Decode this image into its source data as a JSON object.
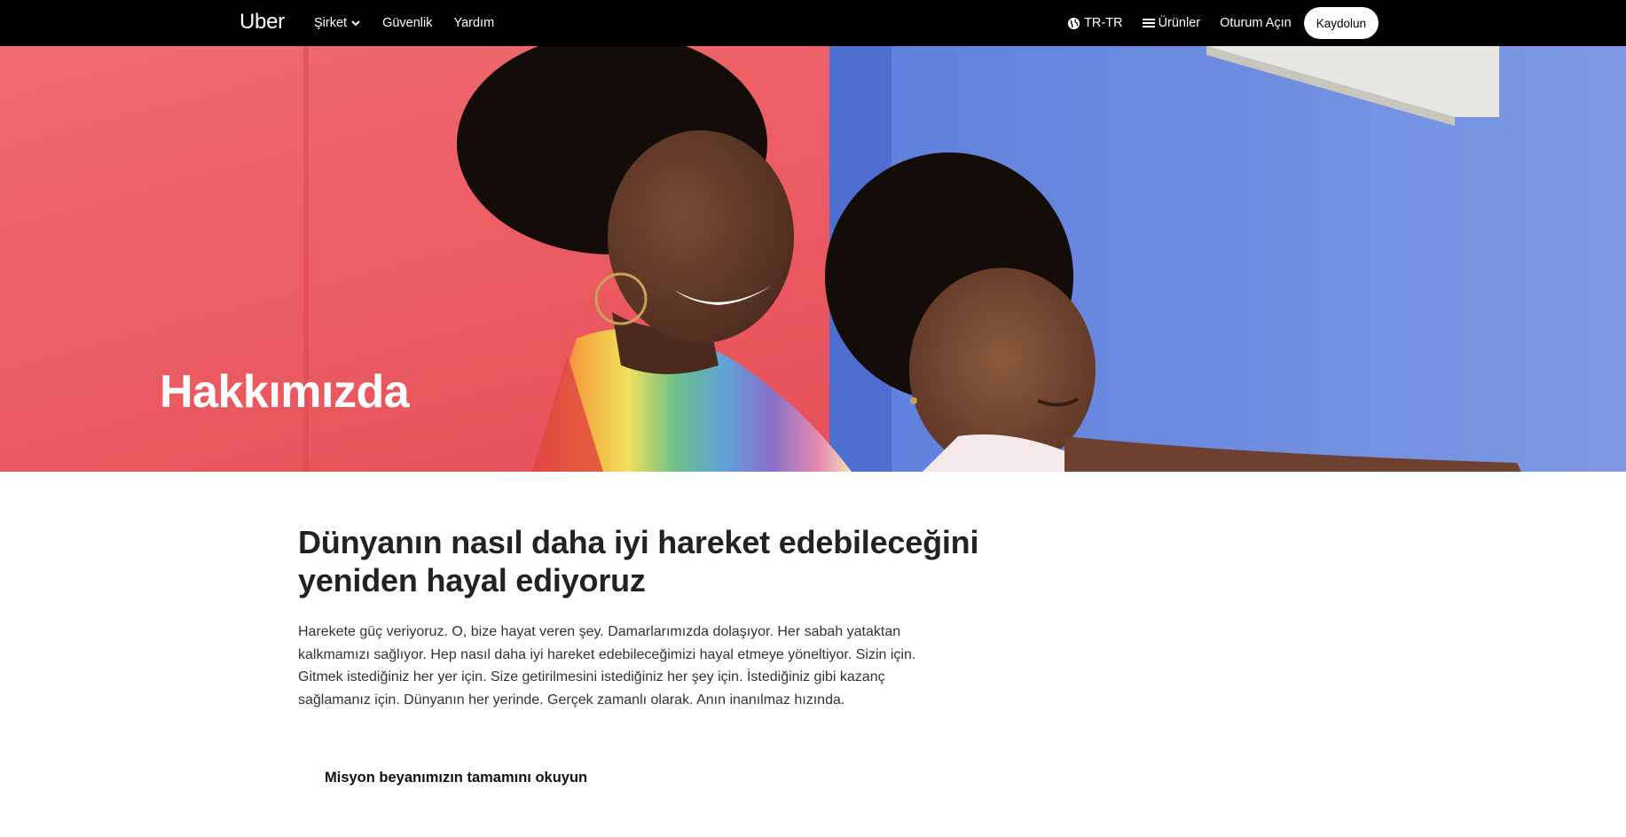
{
  "nav": {
    "brand": "Uber",
    "left_items": [
      {
        "label": "Şirket",
        "has_dropdown": true
      },
      {
        "label": "Güvenlik"
      },
      {
        "label": "Yardım"
      }
    ],
    "locale": "TR-TR",
    "products": "Ürünler",
    "login": "Oturum Açın",
    "signup": "Kaydolun"
  },
  "hero": {
    "title": "Hakkımızda"
  },
  "content": {
    "headline": "Dünyanın nasıl daha iyi hareket edebileceğini yeniden hayal ediyoruz",
    "body": "Harekete güç veriyoruz. O, bize hayat veren şey. Damarlarımızda dolaşıyor. Her sabah yataktan kalkmamızı sağlıyor. Hep nasıl daha iyi hareket edebileceğimizi hayal etmeye yöneltiyor. Sizin için. Gitmek istediğiniz her yer için. Size getirilmesini istediğiniz her şey için. İstediğiniz gibi kazanç sağlamanız için. Dünyanın her yerinde. Gerçek zamanlı olarak. Anın inanılmaz hızında.",
    "mission_link": "Misyon beyanımızın tamamını okuyun"
  },
  "colors": {
    "nav_bg": "#000000",
    "hero_red": "#ec5a60",
    "hero_blue": "#6f8ee0"
  }
}
